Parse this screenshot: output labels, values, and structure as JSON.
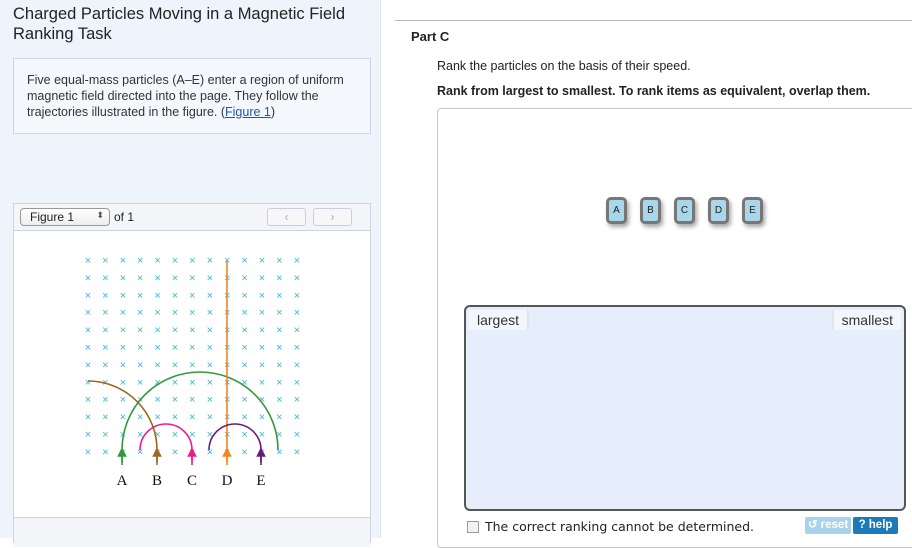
{
  "left": {
    "title": "Charged Particles Moving in a Magnetic Field Ranking Task",
    "description": "Five equal-mass particles (A–E) enter a region of uniform magnetic field directed into the page. They follow the trajectories illustrated in the figure. (",
    "figure_link": "Figure 1",
    "description_end": ")"
  },
  "figure": {
    "select": "Figure 1",
    "of": "of 1",
    "prev": "‹",
    "next": "›",
    "labels": [
      "A",
      "B",
      "C",
      "D",
      "E"
    ],
    "colors": {
      "field": "#3bb5d9",
      "A": "#2e9a3a",
      "B": "#9a6a1e",
      "C": "#ee1a8c",
      "D": "#f7821e",
      "E": "#6a1a7a"
    }
  },
  "part": {
    "title": "Part C",
    "question": "Rank the particles on the basis of their speed.",
    "instruction": "Rank from largest to smallest. To rank items as equivalent, overlap them.",
    "tiles": [
      "A",
      "B",
      "C",
      "D",
      "E"
    ],
    "largest": "largest",
    "smallest": "smallest",
    "cannot_determine": "The correct ranking cannot be determined.",
    "reset": "↺ reset",
    "help": "? help"
  }
}
